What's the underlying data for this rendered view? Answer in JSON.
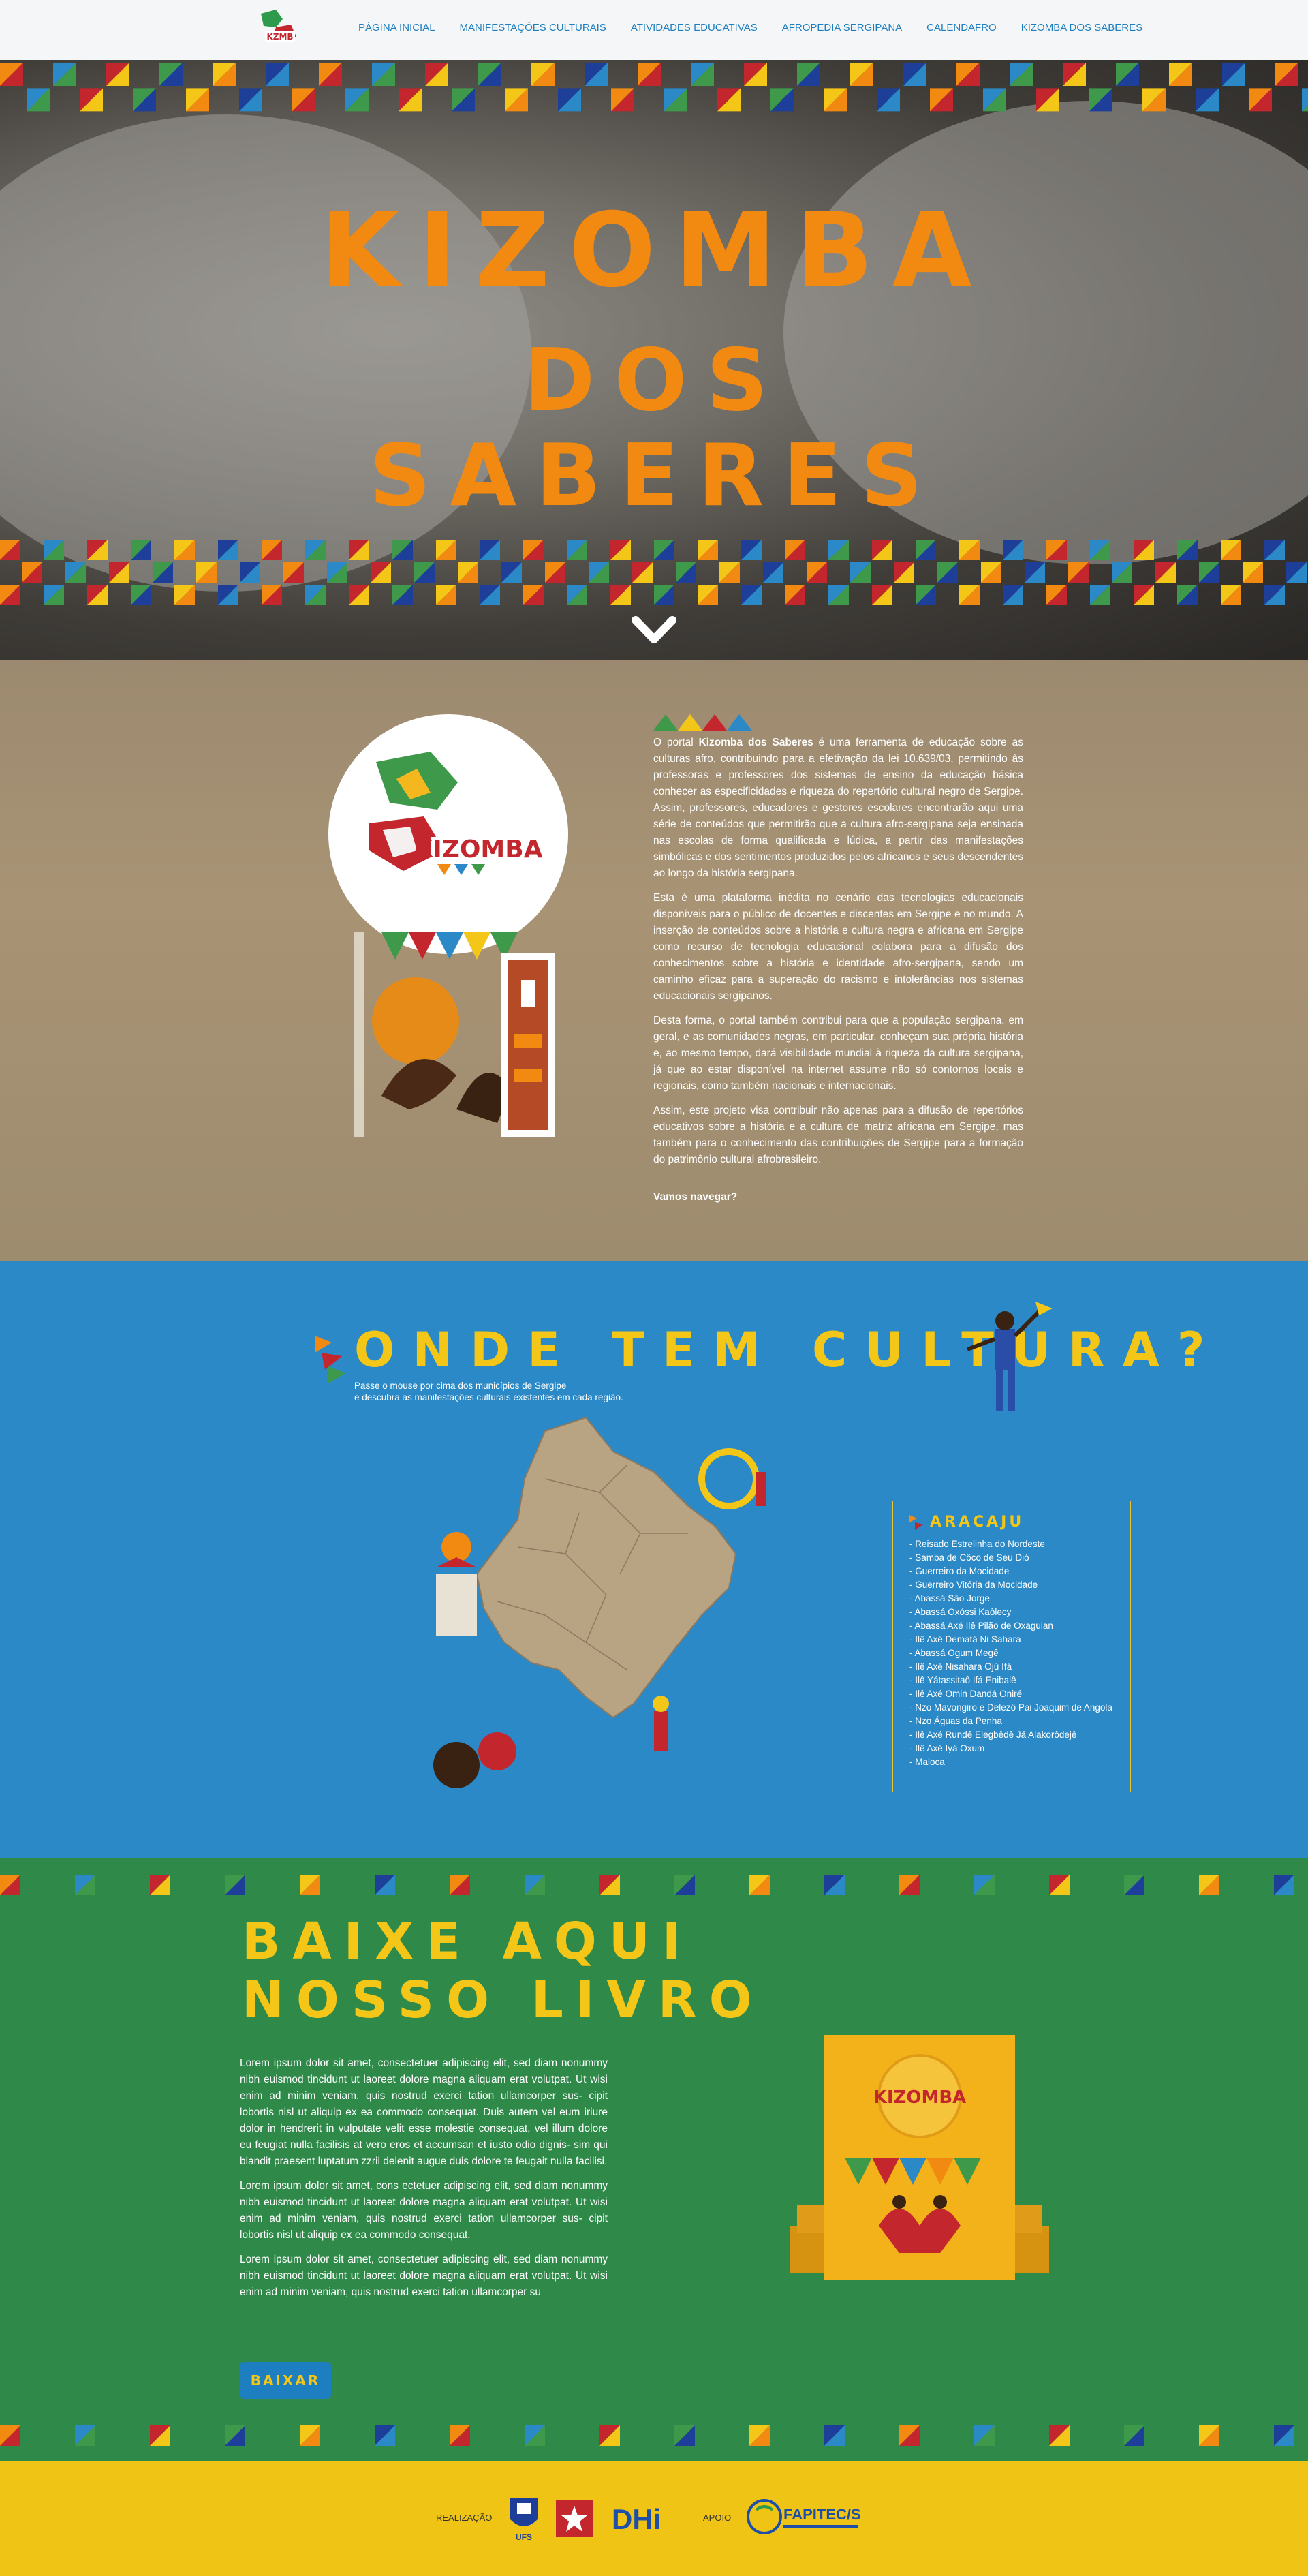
{
  "nav": {
    "items": [
      "PÁGINA INICIAL",
      "MANIFESTAÇÕES CULTURAIS",
      "ATIVIDADES EDUCATIVAS",
      "AFROPEDIA SERGIPANA",
      "CALENDAFRO",
      "KIZOMBA DOS SABERES"
    ]
  },
  "hero": {
    "title_line1": "KIZOMBA",
    "title_line2": "DOS SABERES",
    "scroll_icon": "chevron-down-icon"
  },
  "about": {
    "logo_text": "KIZOMBA",
    "p1_before": "O portal ",
    "p1_strong": "Kizomba dos Saberes",
    "p1_after": " é uma ferramenta de educação sobre as culturas afro, contribuindo para a efetivação da lei 10.639/03, permitindo às professoras e professores dos sistemas de ensino da educação básica conhecer as especificidades e riqueza do repertório cultural negro de Sergipe. Assim, professores, educadores e gestores escolares encontrarão aqui uma série de conteúdos que permitirão que a cultura afro-sergipana seja ensinada nas escolas de forma qualificada e lúdica, a partir das manifestações simbólicas e dos sentimentos produzidos pelos africanos e seus descendentes ao longo da história sergipana.",
    "p2": "Esta é uma plataforma inédita no cenário das tecnologias educacionais disponíveis para o público de docentes e discentes em Sergipe e no mundo. A inserção de conteúdos sobre a história e cultura negra e africana em Sergipe como recurso de tecnologia educacional colabora para a difusão dos conhecimentos sobre a história e identidade afro-sergipana, sendo um caminho eficaz para a superação do racismo e intolerâncias nos sistemas educacionais sergipanos.",
    "p3": "Desta forma, o portal também contribui para que a população sergipana, em geral, e as comunidades negras, em particular, conheçam sua própria história e, ao mesmo tempo, dará visibilidade mundial à riqueza da cultura sergipana, já que ao estar disponível na internet assume não só contornos locais e regionais, como também nacionais e internacionais.",
    "p4": "Assim, este projeto visa contribuir não apenas para a difusão de repertórios educativos sobre a história e a cultura de matriz africana em Sergipe, mas também para o conhecimento das contribuições de Sergipe para a formação do patrimônio cultural afrobrasileiro.",
    "cta": "Vamos navegar?"
  },
  "map": {
    "title": "ONDE TEM CULTURA?",
    "subtitle_line1": "Passe o mouse por cima dos municípios de Sergipe",
    "subtitle_line2": "e descubra as manifestações culturais existentes em cada região.",
    "region": {
      "name": "ARACAJU",
      "items": [
        "Reisado Estrelinha do Nordeste",
        "Samba de Côco de Seu Dió",
        "Guerreiro da Mocidade",
        "Guerreiro Vitória da Mocidade",
        "Abassá São Jorge",
        "Abassá Oxóssi Kaòlecy",
        "Abassá Axé Ilê Pilão de Oxaguian",
        "Ilê Axé Dematá Ni Sahara",
        "Abassá Ogum Megê",
        "Ilê Axé Nisahara Ojú Ifá",
        "Ilê Yátassitaô Ifá Enibalê",
        "Ilê Axé Omin Dandá Oniré",
        "Nzo Mavongiro e Delezô Pai Joaquim de Angola",
        "Nzo Águas da Penha",
        "Ilê Axé Rundê Elegbêdê Já Alakorôdejê",
        "Ilê Axé Iyá Oxum",
        "Maloca"
      ]
    }
  },
  "book": {
    "title_line1": "BAIXE AQUI",
    "title_line2": "NOSSO LIVRO",
    "p1": "Lorem ipsum dolor sit amet, consectetuer adipiscing elit, sed diam nonummy nibh euismod tincidunt ut laoreet dolore magna aliquam erat volutpat. Ut wisi enim ad minim veniam, quis nostrud exerci tation ullamcorper sus- cipit lobortis nisl ut aliquip ex ea commodo consequat. Duis autem vel eum iriure dolor in hendrerit in vulputate velit esse molestie consequat, vel illum dolore eu feugiat nulla facilisis at vero eros et accumsan et iusto odio dignis- sim qui blandit praesent luptatum zzril delenit augue duis dolore te feugait nulla facilisi.",
    "p2": "Lorem ipsum dolor sit amet, cons ectetuer adipiscing elit, sed diam nonummy nibh euismod tincidunt ut laoreet dolore magna aliquam erat volutpat. Ut wisi enim ad minim veniam, quis nostrud exerci tation ullamcorper sus- cipit lobortis nisl ut aliquip ex ea commodo consequat.",
    "p3": "Lorem ipsum dolor sit amet, consectetuer adipiscing elit, sed diam nonummy nibh euismod tincidunt ut laoreet dolore magna aliquam erat volutpat. Ut wisi enim ad minim veniam, quis nostrud exerci tation ullamcorper su",
    "button": "BAIXAR",
    "cover_logo": "KIZOMBA"
  },
  "footer": {
    "label_realizacao": "REALIZAÇÃO",
    "label_apoio": "APOIO",
    "logo_ufs": "UFS",
    "logo_dhi": "DHi",
    "logo_fapitec": "FAPITEC/SE"
  },
  "colors": {
    "orange": "#f28a12",
    "yellow": "#f3c617",
    "blue": "#2a89c6",
    "green": "#2f8a4a",
    "red": "#c4262e"
  }
}
